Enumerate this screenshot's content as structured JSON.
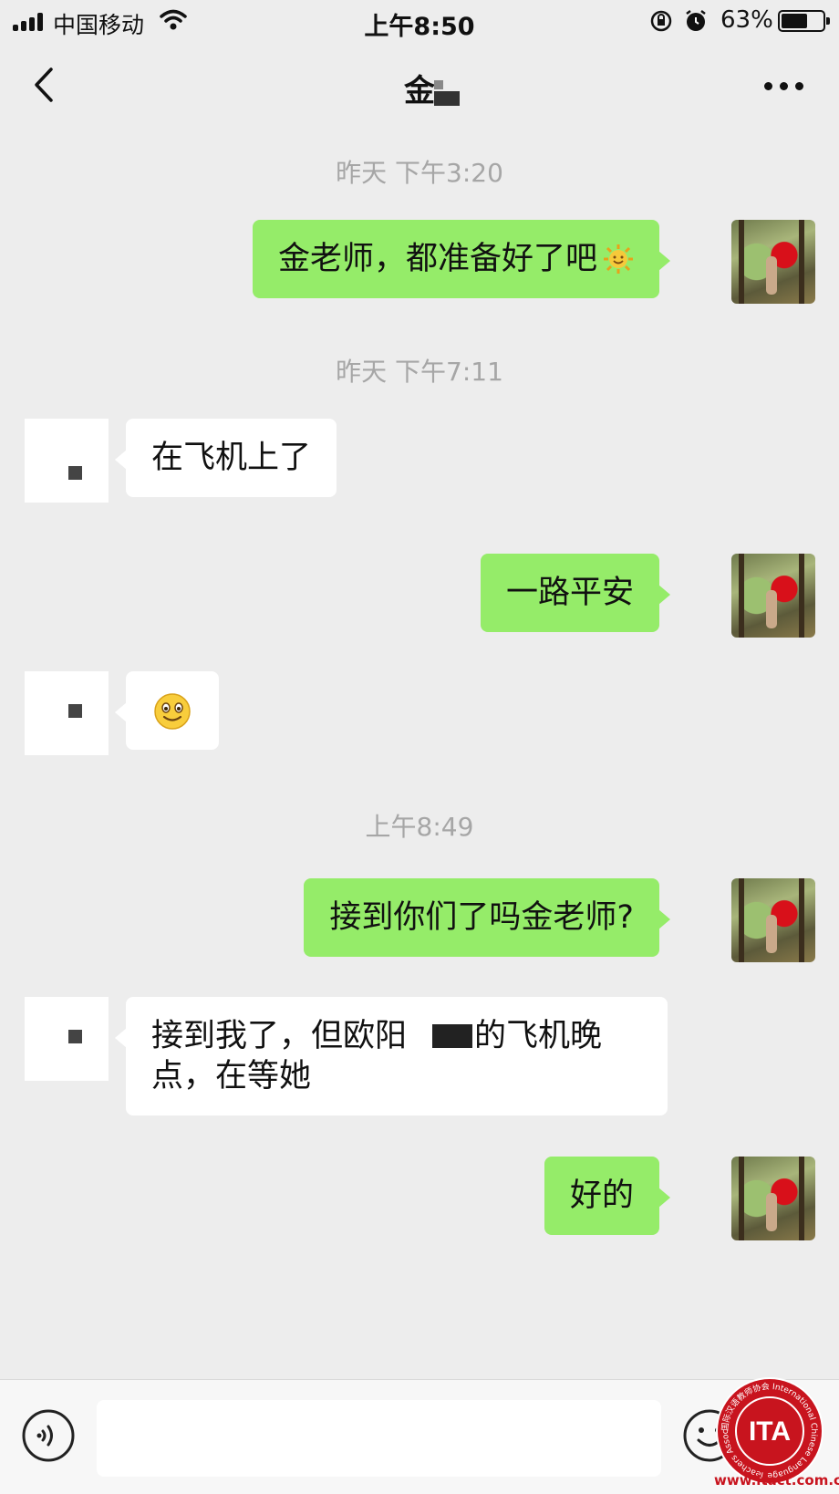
{
  "status_bar": {
    "carrier": "中国移动",
    "time": "上午8:50",
    "battery_percent_text": "63%",
    "battery_level": 0.63
  },
  "nav": {
    "title": "金"
  },
  "messages": {
    "ts1": "昨天 下午3:20",
    "m1": "金老师，都准备好了吧",
    "ts2": "昨天 下午7:11",
    "m2": "在飞机上了",
    "m3": "一路平安",
    "ts3": "上午8:49",
    "m5": "接到你们了吗金老师?",
    "m6_part1": "接到我了，但欧阳",
    "m6_part2": "的飞机晚",
    "m6_line2": "点，在等她",
    "m7": "好的"
  },
  "icons": {
    "sun_emoji": "sun-emoji-icon",
    "smile_emoji": "smile-emoji-icon"
  },
  "watermark": {
    "logo_text": "ITA",
    "ring_text": "国际汉语教师协会 International Chinese Language Teachers Association",
    "url": "www.itact.com.cn"
  },
  "colors": {
    "my_bubble": "#95ec69",
    "their_bubble": "#ffffff",
    "background": "#ededed",
    "watermark_red": "#c8141e"
  }
}
